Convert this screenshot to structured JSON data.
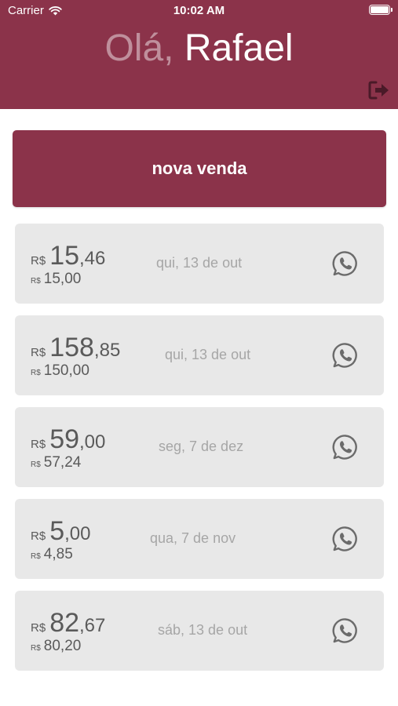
{
  "status_bar": {
    "carrier": "Carrier",
    "time": "10:02 AM"
  },
  "header": {
    "greeting_prefix": "Olá,",
    "user_name": "Rafael"
  },
  "new_sale_button": {
    "label": "nova venda"
  },
  "colors": {
    "brand": "#8b334a",
    "card_bg": "#e8e8e8",
    "amount_text": "#5a5a5a",
    "date_text": "#a6a6a6"
  },
  "sales": [
    {
      "currency": "R$",
      "amount_int": "15",
      "amount_dec": ",46",
      "sub_currency": "R$",
      "sub_amount": "15,00",
      "date": "qui, 13 de out",
      "icon": "whatsapp-icon"
    },
    {
      "currency": "R$",
      "amount_int": "158",
      "amount_dec": ",85",
      "sub_currency": "R$",
      "sub_amount": "150,00",
      "date": "qui, 13 de out",
      "icon": "whatsapp-icon"
    },
    {
      "currency": "R$",
      "amount_int": "59",
      "amount_dec": ",00",
      "sub_currency": "R$",
      "sub_amount": "57,24",
      "date": "seg, 7 de dez",
      "icon": "whatsapp-icon"
    },
    {
      "currency": "R$",
      "amount_int": "5",
      "amount_dec": ",00",
      "sub_currency": "R$",
      "sub_amount": "4,85",
      "date": "qua, 7 de nov",
      "icon": "whatsapp-icon"
    },
    {
      "currency": "R$",
      "amount_int": "82",
      "amount_dec": ",67",
      "sub_currency": "R$",
      "sub_amount": "80,20",
      "date": "sáb, 13 de out",
      "icon": "whatsapp-icon"
    }
  ]
}
